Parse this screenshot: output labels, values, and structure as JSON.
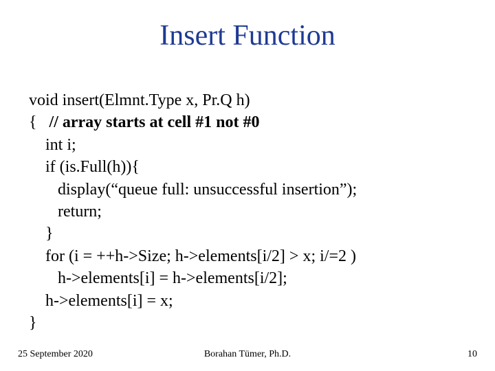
{
  "title": "Insert Function",
  "code": {
    "l0": "void insert(Elmnt.Type x, Pr.Q h)",
    "l1_open": "{   ",
    "l1_comment": "// array starts at cell #1 not #0",
    "l2": "    int i;",
    "l3": "    if (is.Full(h)){",
    "l4": "       display(“queue full: unsuccessful insertion”);",
    "l5": "       return;",
    "l6": "    }",
    "l7": "    for (i = ++h->Size; h->elements[i/2] > x; i/=2 )",
    "l8": "       h->elements[i] = h->elements[i/2];",
    "l9": "    h->elements[i] = x;",
    "l10": "}"
  },
  "footer": {
    "date": "25 September 2020",
    "author": "Borahan Tümer, Ph.D.",
    "page": "10"
  }
}
